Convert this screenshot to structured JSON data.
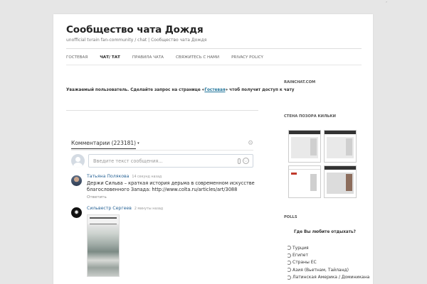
{
  "site": {
    "title": "Сообщество чата Дождя",
    "description": "unofficial tvrain fan-community / chat | Сообщество чата Дождя"
  },
  "nav": {
    "items": [
      {
        "label": "Гостевая",
        "active": false
      },
      {
        "label": "Чат/ Тат",
        "active": true
      },
      {
        "label": "Правила чата",
        "active": false
      },
      {
        "label": "Свяжитесь с нами",
        "active": false
      },
      {
        "label": "Privacy Policy",
        "active": false
      }
    ]
  },
  "notice": {
    "before": "Уважаемый пользователь. Сделайте запрос на странице «",
    "link": "Гостевая",
    "after": "» чтоб получит доступ к чату"
  },
  "comments": {
    "count_label": "Комментарии (223181)",
    "caret": "▾",
    "input_placeholder": "Введите текст сообщения...",
    "items": [
      {
        "author": "Татьяна Полякова",
        "time": "14 секунд назад",
        "lines": [
          "Держи Сильва – краткая история дерьма в современном искусстве",
          "благословенного Запада: http://www.colta.ru/articles/art/3088"
        ],
        "reply": "Ответить"
      },
      {
        "author": "Сильвестр Сергеев",
        "time": "2 минуты назад",
        "has_image": true
      }
    ]
  },
  "sidebar": {
    "rainchat_heading": "RAINCHAT.COM",
    "wall_heading": "СТЕНА ПОЗОРА КИЛЬКИ",
    "polls_heading": "POLLS",
    "poll": {
      "question": "Где Вы любите отдыхать?",
      "options": [
        "Турция",
        "Египет",
        "Страны ЕС",
        "Азия (Вьетнам, Тайланд)",
        "Латинская Америка / Доминикана"
      ]
    }
  },
  "colors": {
    "link": "#21759b",
    "author": "#2a6496",
    "page_bg": "#e6e6e6"
  },
  "icons": {
    "settings": "gear-icon",
    "attach": "paperclip-icon",
    "emoji": "smile-icon"
  }
}
